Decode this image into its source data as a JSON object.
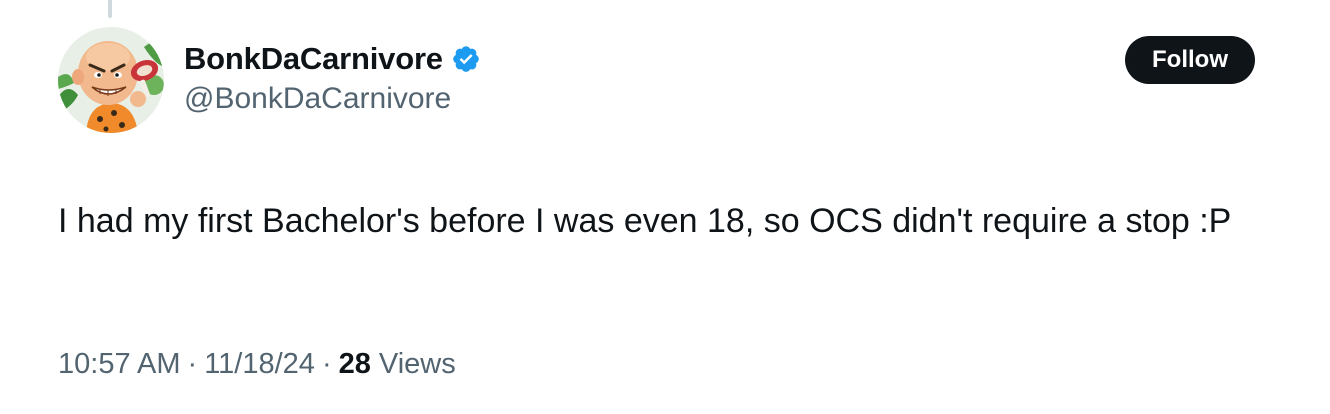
{
  "author": {
    "display_name": "BonkDaCarnivore",
    "handle": "@BonkDaCarnivore",
    "verified_icon": "verified-badge-icon",
    "avatar_icon": "cartoon-caveman-avatar"
  },
  "follow_button": {
    "label": "Follow"
  },
  "tweet": {
    "text": "I had my first Bachelor's before I was even 18, so OCS didn't require a stop :P"
  },
  "meta": {
    "time": "10:57 AM",
    "separator": "·",
    "date": "11/18/24",
    "views_count": "28",
    "views_label": "Views"
  },
  "colors": {
    "primary_text": "#0f1419",
    "secondary_text": "#536471",
    "verified_blue": "#1d9bf0",
    "button_bg": "#0f1419",
    "button_text": "#ffffff"
  }
}
